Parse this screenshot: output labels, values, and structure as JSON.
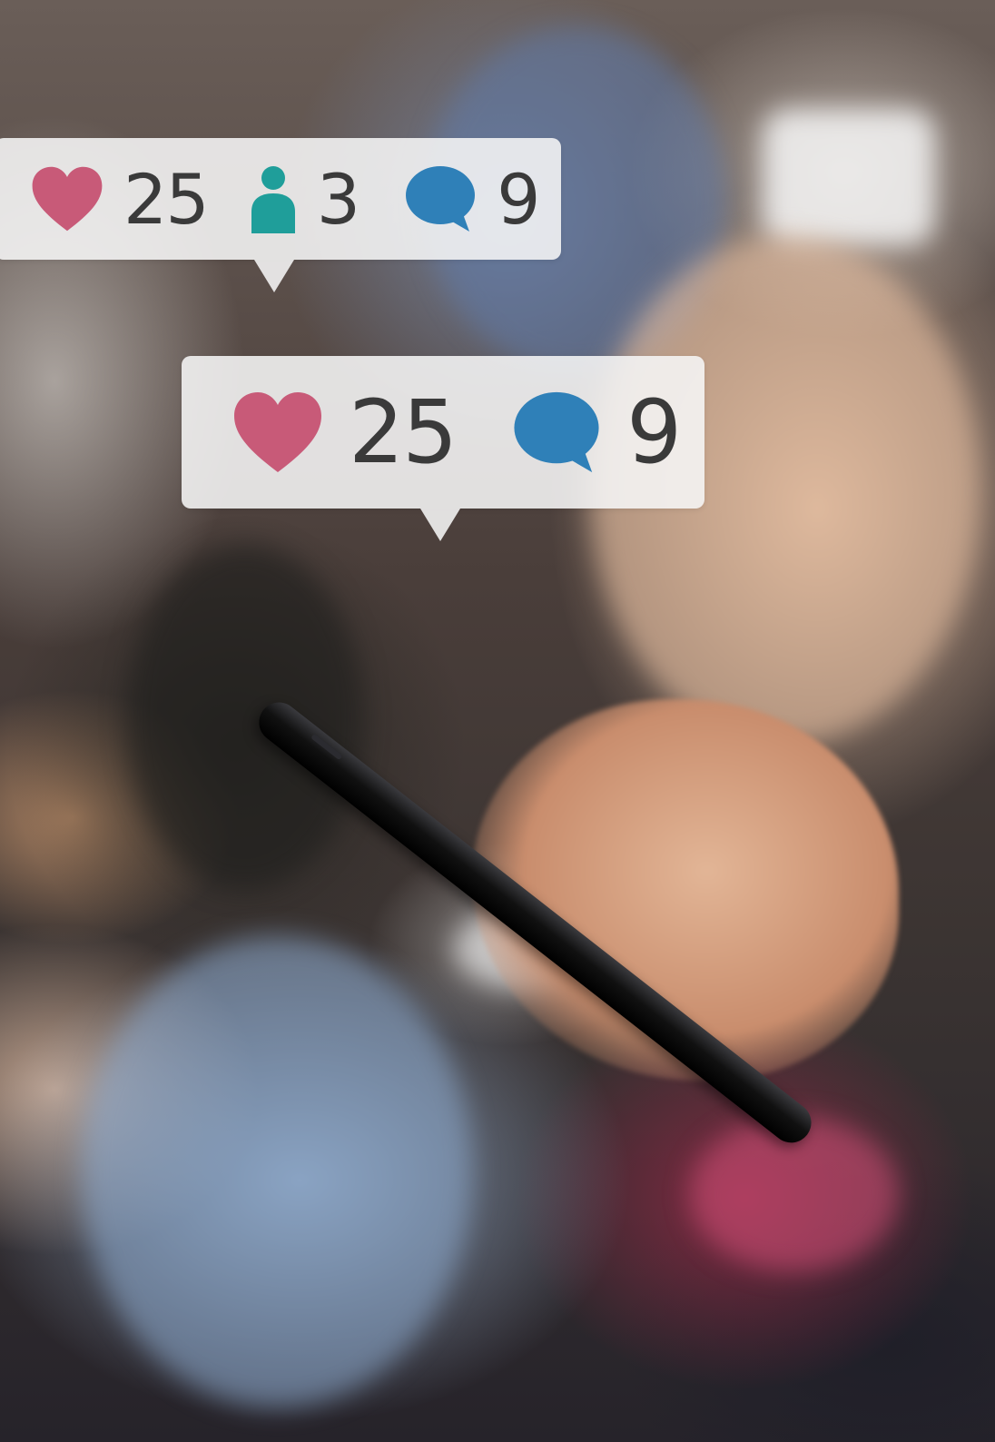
{
  "colors": {
    "heart": "#c85a78",
    "person": "#1f9e9a",
    "comment": "#2f80b8",
    "count_text": "#3a3a3a",
    "bubble_bg": "#f6f6f6"
  },
  "notifications": [
    {
      "likes": "25",
      "followers": "3",
      "comments": "9",
      "icons": [
        "heart-icon",
        "person-icon",
        "comment-icon"
      ]
    },
    {
      "likes": "25",
      "comments": "9",
      "icons": [
        "heart-icon",
        "comment-icon"
      ]
    }
  ]
}
